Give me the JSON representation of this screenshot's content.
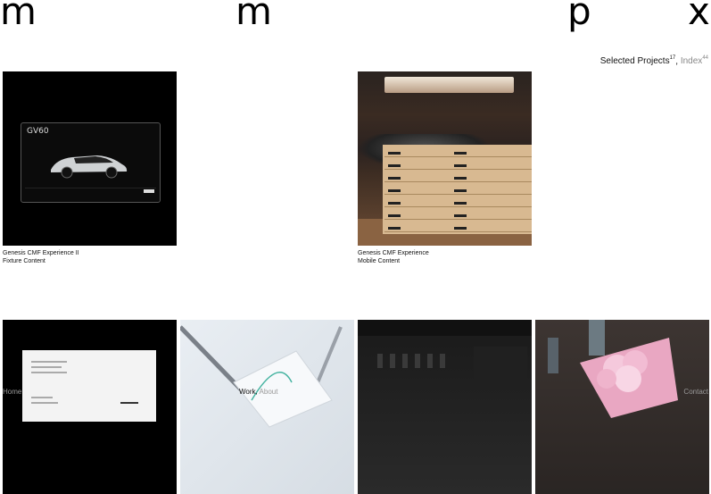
{
  "logo": {
    "letters": [
      "m",
      "m",
      "p",
      "x"
    ]
  },
  "filter": {
    "selected_label": "Selected Projects",
    "selected_count": "17",
    "separator": ",",
    "index_label": "Index",
    "index_count": "44"
  },
  "projects": [
    {
      "title": "Genesis CMF Experience II",
      "subtitle": "Fixture Content",
      "thumb_text": "GV60"
    },
    {
      "title": "Genesis CMF Experience",
      "subtitle": "Mobile Content"
    }
  ],
  "bottom_nav": {
    "home": "Home",
    "work": "Work",
    "work_separator": ",",
    "about": "About",
    "contact": "Contact"
  },
  "colors": {
    "background": "#ffffff",
    "text": "#111111",
    "muted": "#888888"
  }
}
